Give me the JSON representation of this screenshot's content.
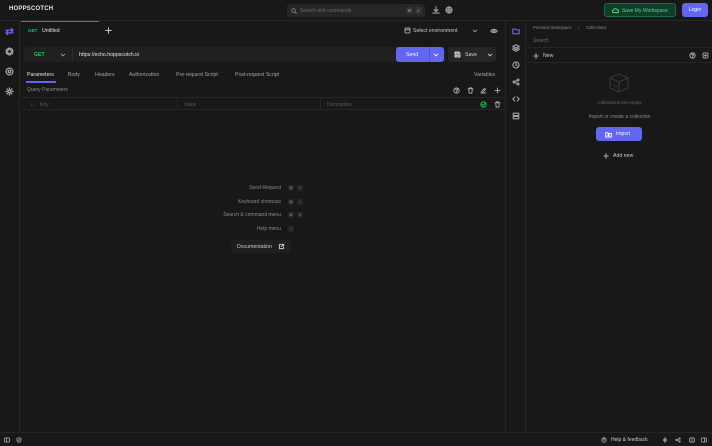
{
  "header": {
    "logo": "HOPPSCOTCH",
    "search_placeholder": "Search and commands",
    "search_keys": [
      "⌘",
      "K"
    ],
    "save_workspace": "Save My Workspace",
    "login": "Login"
  },
  "tabs": [
    {
      "method": "GET",
      "title": "Untitled"
    }
  ],
  "environment": {
    "label": "Select environment"
  },
  "request": {
    "method": "GET",
    "url": "https://echo.hoppscotch.io",
    "send_label": "Send",
    "save_label": "Save"
  },
  "subtabs": [
    "Parameters",
    "Body",
    "Headers",
    "Authorization",
    "Pre-request Script",
    "Post-request Script"
  ],
  "variables_label": "Variables",
  "query_params": {
    "title": "Query Parameters",
    "key_placeholder": "Key",
    "value_placeholder": "Value",
    "description_placeholder": "Description"
  },
  "shortcuts": [
    {
      "label": "Send Request",
      "keys": [
        "⌘",
        "↵"
      ]
    },
    {
      "label": "Keyboard shortcuts",
      "keys": [
        "⌘",
        "/"
      ]
    },
    {
      "label": "Search & command menu",
      "keys": [
        "⌘",
        "K"
      ]
    },
    {
      "label": "Help menu",
      "keys": [
        "?"
      ]
    }
  ],
  "documentation": "Documentation",
  "right_panel": {
    "breadcrumb": [
      "Personal Workspace",
      "Collections"
    ],
    "search_placeholder": "Search",
    "new_label": "New",
    "empty_title": "Collections are empty",
    "empty_subtitle": "Import or create a collection",
    "import_label": "Import",
    "add_new_label": "Add new"
  },
  "footer": {
    "help_feedback": "Help & feedback"
  },
  "colors": {
    "accent": "#6366f1",
    "get_method": "#22c55e",
    "workspace_green": "#4ade80",
    "background": "#181818"
  }
}
